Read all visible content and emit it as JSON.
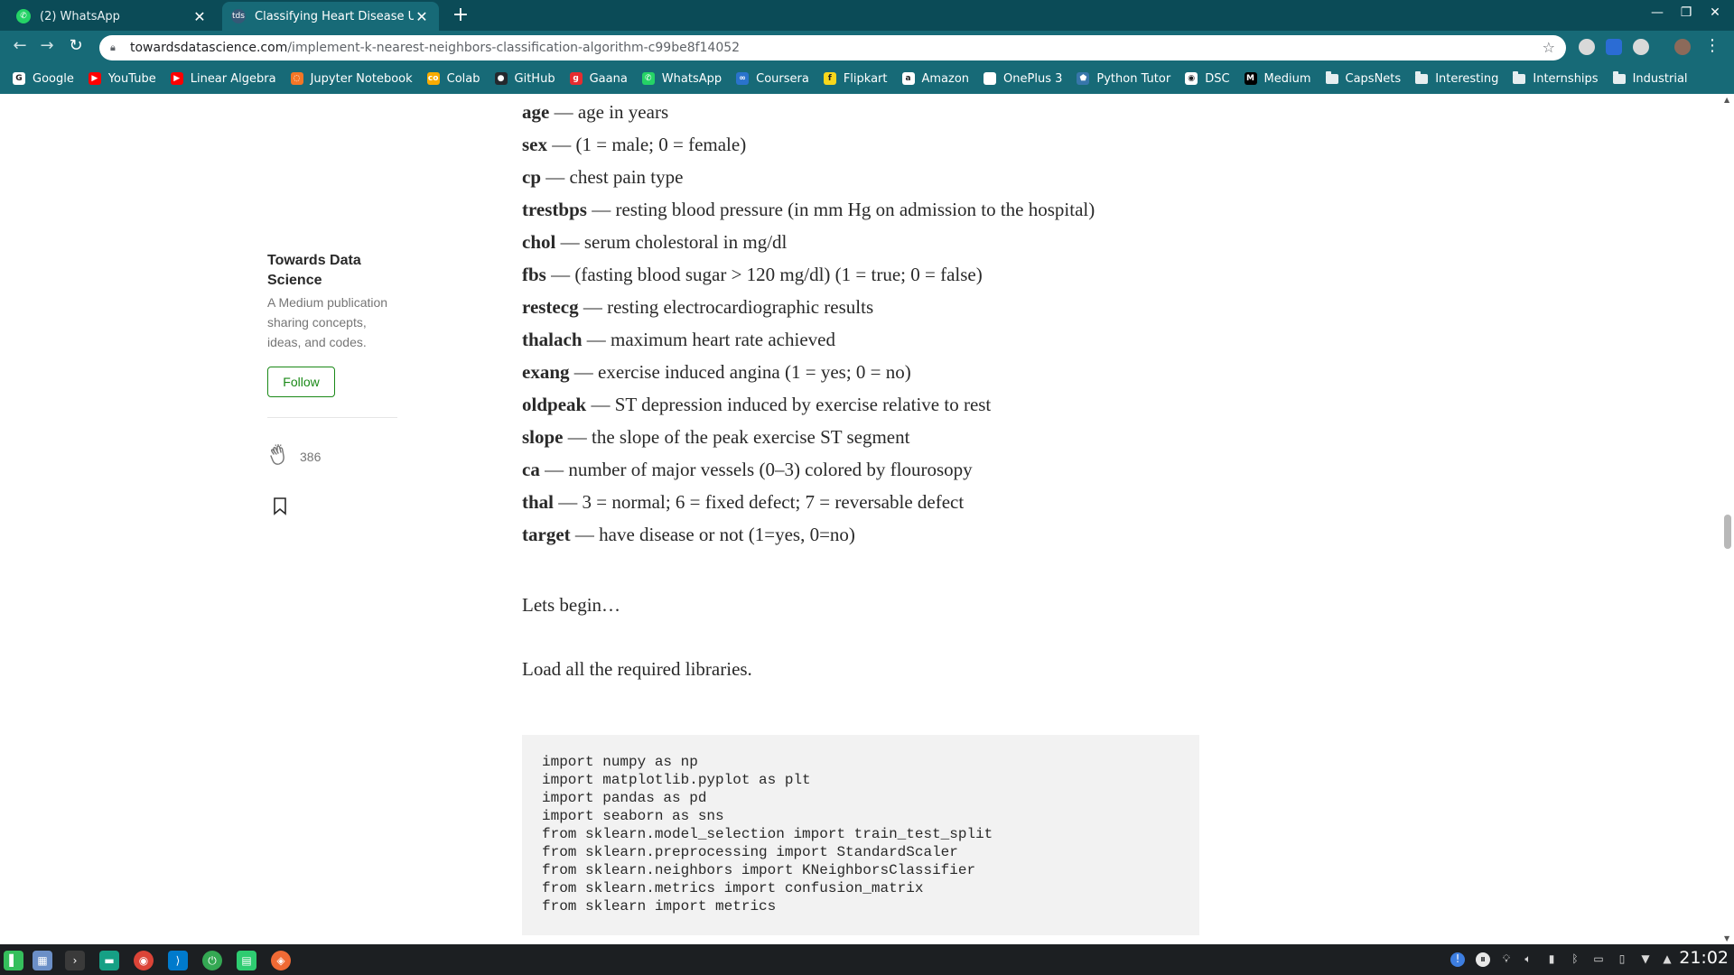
{
  "browser": {
    "tabs": [
      {
        "title": "(2) WhatsApp",
        "active": false,
        "icon": "whatsapp-icon"
      },
      {
        "title": "Classifying Heart Disease Usi",
        "active": true,
        "icon": "tds-icon",
        "icon_text": "tds"
      }
    ],
    "url_host": "towardsdatascience.com",
    "url_path": "/implement-k-nearest-neighbors-classification-algorithm-c99be8f14052",
    "bookmarks": [
      {
        "label": "Google",
        "icon": "google-icon",
        "color": "#ffffff",
        "glyph": "G"
      },
      {
        "label": "YouTube",
        "icon": "youtube-icon",
        "color": "#ff0000",
        "glyph": "▶"
      },
      {
        "label": "Linear Algebra",
        "icon": "youtube-icon",
        "color": "#ff0000",
        "glyph": "▶"
      },
      {
        "label": "Jupyter Notebook",
        "icon": "jupyter-icon",
        "color": "#f37626",
        "glyph": "◌"
      },
      {
        "label": "Colab",
        "icon": "colab-icon",
        "color": "#f9ab00",
        "glyph": "co"
      },
      {
        "label": "GitHub",
        "icon": "github-icon",
        "color": "#24292e",
        "glyph": "●"
      },
      {
        "label": "Gaana",
        "icon": "gaana-icon",
        "color": "#e72c30",
        "glyph": "g"
      },
      {
        "label": "WhatsApp",
        "icon": "whatsapp-icon",
        "color": "#25d366",
        "glyph": "✆"
      },
      {
        "label": "Coursera",
        "icon": "coursera-icon",
        "color": "#2a73cc",
        "glyph": "∞"
      },
      {
        "label": "Flipkart",
        "icon": "flipkart-icon",
        "color": "#f8d71c",
        "glyph": "f"
      },
      {
        "label": "Amazon",
        "icon": "amazon-icon",
        "color": "#ffffff",
        "glyph": "a"
      },
      {
        "label": "OnePlus 3",
        "icon": "page-icon",
        "color": "#ffffff",
        "glyph": ""
      },
      {
        "label": "Python Tutor",
        "icon": "python-icon",
        "color": "#3776ab",
        "glyph": "⬟"
      },
      {
        "label": "DSC",
        "icon": "dsc-icon",
        "color": "#ffffff",
        "glyph": "◉"
      },
      {
        "label": "Medium",
        "icon": "medium-icon",
        "color": "#000000",
        "glyph": "M"
      },
      {
        "label": "CapsNets",
        "icon": "folder-icon",
        "folder": true
      },
      {
        "label": "Interesting",
        "icon": "folder-icon",
        "folder": true
      },
      {
        "label": "Internships",
        "icon": "folder-icon",
        "folder": true
      },
      {
        "label": "Industrial",
        "icon": "folder-icon",
        "folder": true
      }
    ]
  },
  "sidebar": {
    "publication": "Towards Data Science",
    "description": "A Medium publication sharing concepts, ideas, and codes.",
    "follow_label": "Follow",
    "claps": "386"
  },
  "article": {
    "fields": [
      {
        "name": "age",
        "desc": " — age in years"
      },
      {
        "name": "sex",
        "desc": " — (1 = male; 0 = female)"
      },
      {
        "name": "cp",
        "desc": " — chest pain type"
      },
      {
        "name": "trestbps",
        "desc": " — resting blood pressure (in mm Hg on admission to the hospital)"
      },
      {
        "name": "chol",
        "desc": " — serum cholestoral in mg/dl"
      },
      {
        "name": "fbs",
        "desc": " — (fasting blood sugar > 120 mg/dl) (1 = true; 0 = false)"
      },
      {
        "name": "restecg",
        "desc": " — resting electrocardiographic results"
      },
      {
        "name": "thalach",
        "desc": " — maximum heart rate achieved"
      },
      {
        "name": "exang",
        "desc": " — exercise induced angina (1 = yes; 0 = no)"
      },
      {
        "name": "oldpeak",
        "desc": " — ST depression induced by exercise relative to rest"
      },
      {
        "name": "slope",
        "desc": " — the slope of the peak exercise ST segment"
      },
      {
        "name": "ca",
        "desc": " — number of major vessels (0–3) colored by flourosopy"
      },
      {
        "name": "thal",
        "desc": " — 3 = normal; 6 = fixed defect; 7 = reversable defect"
      },
      {
        "name": "target",
        "desc": " — have disease or not (1=yes, 0=no)"
      }
    ],
    "para1": "Lets begin…",
    "para2": "Load all the required libraries.",
    "code": [
      "import numpy as np",
      "import matplotlib.pyplot as plt",
      "import pandas as pd",
      "import seaborn as sns",
      "from sklearn.model_selection import train_test_split",
      "from sklearn.preprocessing import StandardScaler",
      "from sklearn.neighbors import KNeighborsClassifier",
      "from sklearn.metrics import confusion_matrix",
      "from sklearn import metrics"
    ]
  },
  "taskbar": {
    "apps": [
      {
        "icon": "manjaro-menu-icon",
        "color": "#35bf5c"
      },
      {
        "icon": "desktop-icon",
        "color": "#6b8fc7"
      },
      {
        "icon": "terminal-icon",
        "color": "#3a3a3a"
      },
      {
        "icon": "file-manager-icon",
        "color": "#16a085"
      },
      {
        "icon": "chrome-icon",
        "color": "#db4437"
      },
      {
        "icon": "vscode-icon",
        "color": "#007acc"
      },
      {
        "icon": "power-icon",
        "color": "#34a853"
      },
      {
        "icon": "document-icon",
        "color": "#2ecc71"
      },
      {
        "icon": "compass-icon",
        "color": "#f06a35"
      }
    ],
    "clock": "21:02"
  }
}
